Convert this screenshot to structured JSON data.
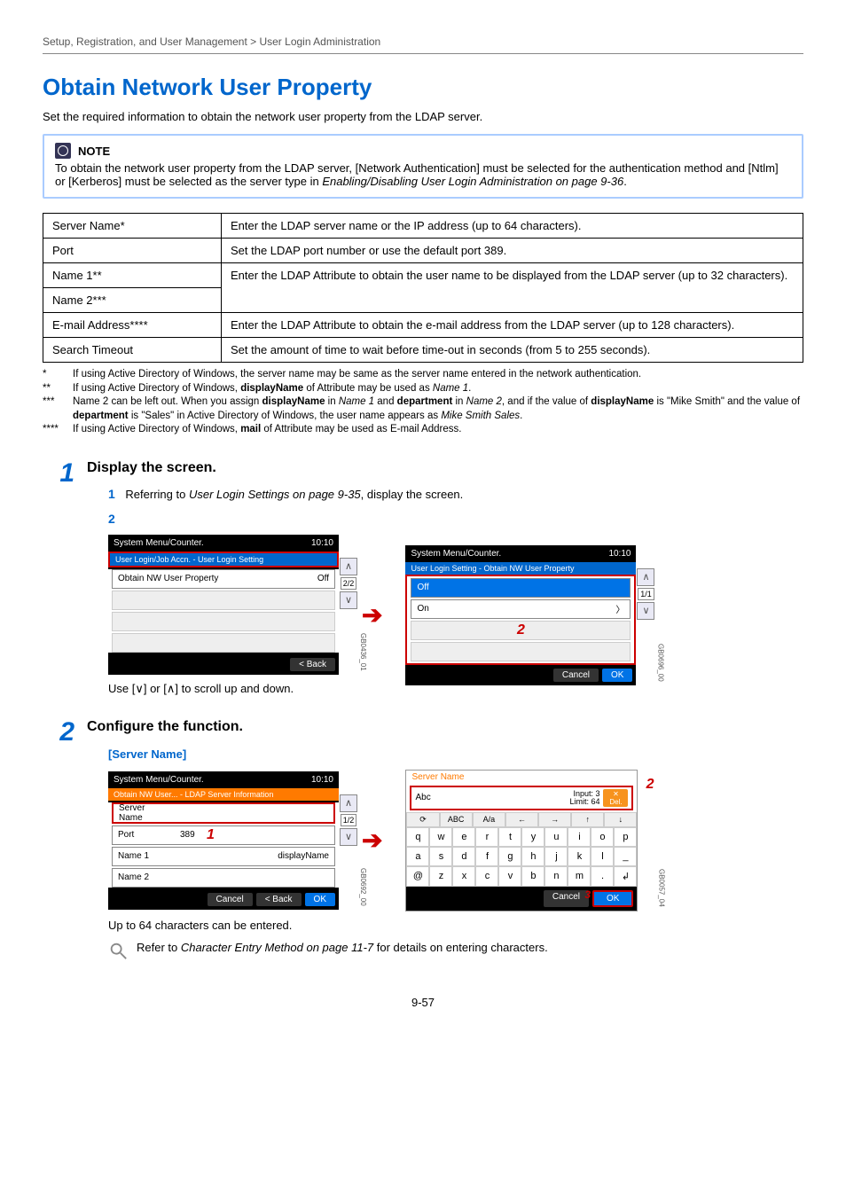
{
  "breadcrumb": "Setup, Registration, and User Management > User Login Administration",
  "title": "Obtain Network User Property",
  "intro": "Set the required information to obtain the network user property from the LDAP server.",
  "note": {
    "label": "NOTE",
    "body_pre": "To obtain the network user property from the LDAP server, [Network Authentication] must be selected for the authentication method and [Ntlm] or [Kerberos] must be selected as the server type in ",
    "body_ref": "Enabling/Disabling User Login Administration on page 9-36",
    "body_post": "."
  },
  "table": {
    "rows": [
      {
        "k": "Server Name*",
        "v": "Enter the LDAP server name or the IP address (up to 64 characters)."
      },
      {
        "k": "Port",
        "v": "Set the LDAP port number or use the default port 389."
      },
      {
        "k": "Name 1**",
        "v": "Enter the LDAP Attribute to obtain the user name to be displayed from the LDAP server (up to 32 characters)."
      },
      {
        "k": "Name 2***",
        "v": ""
      },
      {
        "k": "E-mail Address****",
        "v": "Enter the LDAP Attribute to obtain the e-mail address from the LDAP server (up to 128 characters)."
      },
      {
        "k": "Search Timeout",
        "v": "Set the amount of time to wait before time-out in seconds (from 5 to 255 seconds)."
      }
    ]
  },
  "footnotes": [
    {
      "mark": "*",
      "text": "If using Active Directory of Windows, the server name may be same as the server name entered in the network authentication."
    },
    {
      "mark": "**",
      "text_parts": [
        "If using Active Directory of Windows, ",
        {
          "b": "displayName"
        },
        " of Attribute may be used as ",
        {
          "i": "Name 1"
        },
        "."
      ]
    },
    {
      "mark": "***",
      "text_parts": [
        "Name 2 can be left out. When you assign ",
        {
          "b": "displayName"
        },
        " in ",
        {
          "i": "Name 1"
        },
        " and ",
        {
          "b": "department"
        },
        " in ",
        {
          "i": "Name 2"
        },
        ", and if the value of ",
        {
          "b": "displayName"
        },
        " is \"Mike Smith\" and the value of ",
        {
          "b": "department"
        },
        " is \"Sales\" in Active Directory of Windows, the user name appears as ",
        {
          "i": "Mike Smith Sales"
        },
        "."
      ]
    },
    {
      "mark": "****",
      "text_parts": [
        "If using Active Directory of Windows, ",
        {
          "b": "mail"
        },
        " of Attribute may be used as E-mail Address."
      ]
    }
  ],
  "step1": {
    "num": "1",
    "title": "Display the screen.",
    "sub1_num": "1",
    "sub1_pre": "Referring to ",
    "sub1_ref": "User Login Settings on page 9-35",
    "sub1_post": ", display the screen.",
    "sub2_num": "2",
    "scroll_hint": "Use [∨] or [∧] to scroll up and down."
  },
  "screenA": {
    "title": "System Menu/Counter.",
    "time": "10:10",
    "crumb": "User Login/Job Accn. - User Login Setting",
    "row1": "Obtain NW User Property",
    "row1_val": "Off",
    "page": "2/2",
    "back": "< Back",
    "imgid": "GB0436_01"
  },
  "screenB": {
    "title": "System Menu/Counter.",
    "time": "10:10",
    "crumb": "User Login Setting - Obtain NW User Property",
    "opt_off": "Off",
    "opt_on": "On",
    "page": "1/1",
    "cancel": "Cancel",
    "ok": "OK",
    "callout": "2",
    "imgid": "GB0696_00"
  },
  "step2": {
    "num": "2",
    "title": "Configure the function.",
    "head": "[Server Name]",
    "caption": "Up to 64 characters can be entered.",
    "ref_pre": "Refer to ",
    "ref_link": "Character Entry Method on page 11-7",
    "ref_post": " for details on entering characters."
  },
  "screenC": {
    "title": "System Menu/Counter.",
    "time": "10:10",
    "crumb": "Obtain NW User... - LDAP Server Information",
    "server_name_lbl": "Server Name",
    "server_name_val": "",
    "port_lbl": "Port",
    "port_val": "389",
    "name1_lbl": "Name 1",
    "name1_val": "displayName",
    "name2_lbl": "Name 2",
    "name2_val": "",
    "page": "1/2",
    "cancel": "Cancel",
    "back": "< Back",
    "ok": "OK",
    "callout": "1",
    "imgid": "GB0692_00"
  },
  "keyboard": {
    "title": "Server Name",
    "entry": "Abc",
    "input_label": "Input: 3",
    "limit_label": "Limit: 64",
    "del": "Del.",
    "tab_abc": "ABC",
    "tab_case": "A/a",
    "rows": [
      [
        "q",
        "w",
        "e",
        "r",
        "t",
        "y",
        "u",
        "i",
        "o",
        "p"
      ],
      [
        "a",
        "s",
        "d",
        "f",
        "g",
        "h",
        "j",
        "k",
        "l",
        "_"
      ],
      [
        "@",
        "z",
        "x",
        "c",
        "v",
        "b",
        "n",
        "m",
        ".",
        "↲"
      ]
    ],
    "cancel": "Cancel",
    "ok": "OK",
    "callout_side": "2",
    "callout_ok": "3",
    "imgid": "GB0057_04"
  },
  "pagenum": "9-57"
}
